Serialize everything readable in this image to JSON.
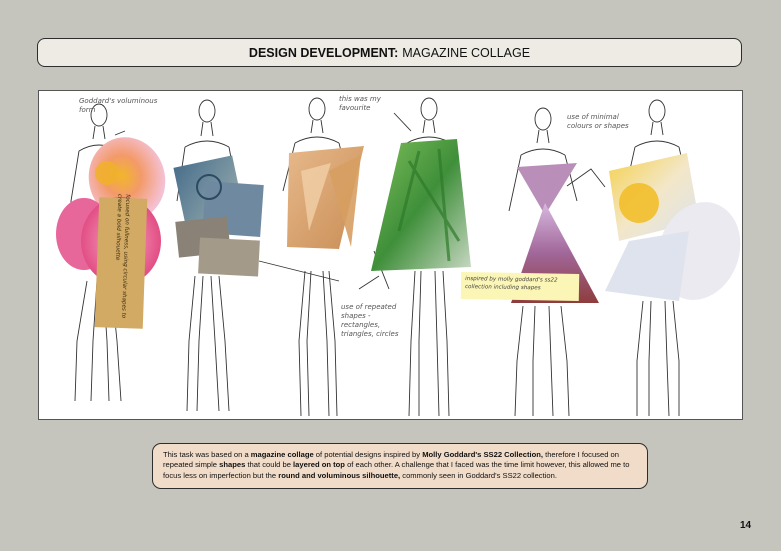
{
  "header": {
    "title_bold": "DESIGN DEVELOPMENT:",
    "title_rest": "MAGAZINE COLLAGE"
  },
  "collage": {
    "notes": {
      "goddard": "Goddard's voluminous form",
      "favourite": "this was my favourite",
      "repeated": "use of repeated shapes - rectangles, triangles, circles",
      "minimal": "use of minimal colours or shapes",
      "inspired": "inspired by molly goddard's ss22 collection including shapes",
      "kraft": "focused on fullness, using circular shapes to create a bold silhouette"
    }
  },
  "caption": {
    "p1": "This task was based on a ",
    "b1": "magazine collage",
    "p2": " of potential designs inspired by ",
    "b2": "Molly Goddard's SS22 Collection,",
    "p3": " therefore I focused on repeated simple ",
    "b3": "shapes",
    "p4": " that could be ",
    "b4": "layered on top",
    "p5": " of each other. A challenge that I faced was the time limit however, this allowed me to focus less on imperfection but the ",
    "b5": "round and voluminous silhouette,",
    "p6": " commonly seen in Goddard's SS22 collection."
  },
  "page": {
    "number": "14"
  },
  "colors": {
    "background": "#c6c5bd",
    "title_box": "#edebe4",
    "caption_box": "#f0dcc9"
  }
}
